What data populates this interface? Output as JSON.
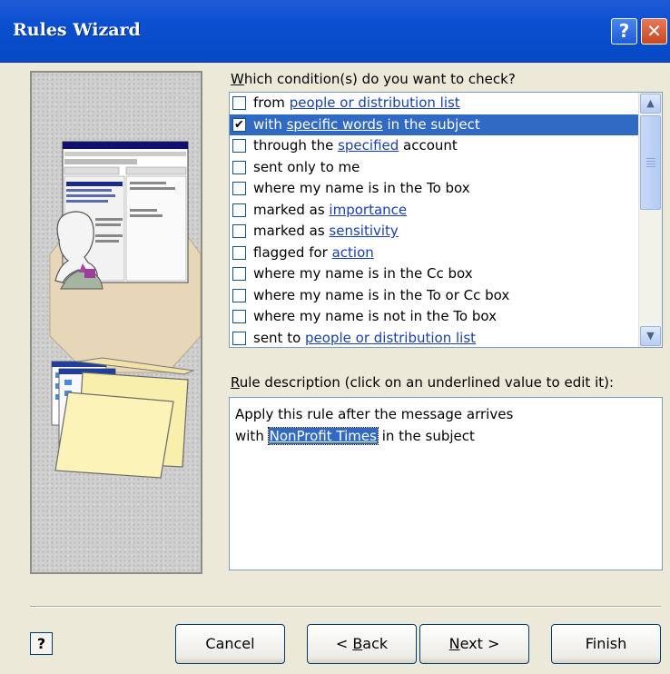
{
  "window": {
    "title": "Rules Wizard",
    "help_glyph": "?",
    "close_glyph": "✕"
  },
  "conditions": {
    "prompt": "Which condition(s) do you want to check?",
    "items": [
      {
        "pre": "from ",
        "link": "people or distribution list",
        "post": "",
        "checked": false
      },
      {
        "pre": "with ",
        "link": "specific words",
        "post": " in the subject",
        "checked": true,
        "selected": true
      },
      {
        "pre": "through the ",
        "link": "specified",
        "post": " account",
        "checked": false
      },
      {
        "pre": "sent only to me",
        "link": "",
        "post": "",
        "checked": false
      },
      {
        "pre": "where my name is in the To box",
        "link": "",
        "post": "",
        "checked": false
      },
      {
        "pre": "marked as ",
        "link": "importance",
        "post": "",
        "checked": false
      },
      {
        "pre": "marked as ",
        "link": "sensitivity",
        "post": "",
        "checked": false
      },
      {
        "pre": "flagged for ",
        "link": "action",
        "post": "",
        "checked": false
      },
      {
        "pre": "where my name is in the Cc box",
        "link": "",
        "post": "",
        "checked": false
      },
      {
        "pre": "where my name is in the To or Cc box",
        "link": "",
        "post": "",
        "checked": false
      },
      {
        "pre": "where my name is not in the To box",
        "link": "",
        "post": "",
        "checked": false
      },
      {
        "pre": "sent to ",
        "link": "people or distribution list",
        "post": "",
        "checked": false
      }
    ]
  },
  "description": {
    "label": "Rule description (click on an underlined value to edit it):",
    "line1": "Apply this rule after the message arrives",
    "line2_pre": "with ",
    "line2_value": "NonProfit Times",
    "line2_post": " in the subject"
  },
  "buttons": {
    "context_help": "?",
    "cancel": "Cancel",
    "back": "< Back",
    "next": "Next >",
    "finish": "Finish"
  },
  "colors": {
    "title_bar": "#0a4fd0",
    "selection": "#316ac5",
    "link": "#1a41a9",
    "dialog_bg": "#ece9d8"
  }
}
